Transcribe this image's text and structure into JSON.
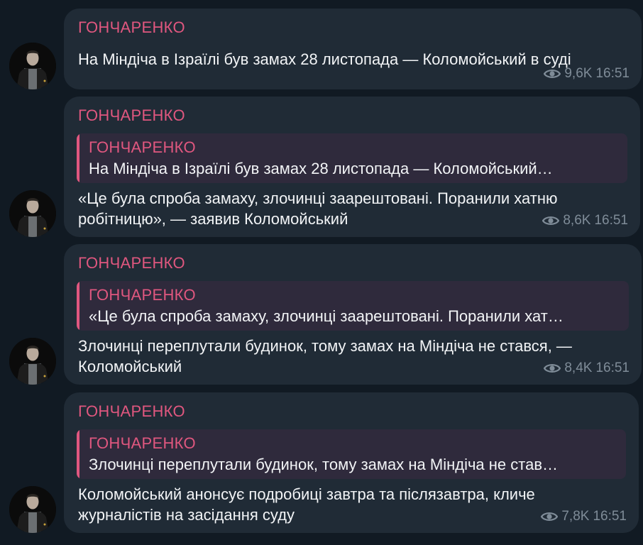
{
  "messages": [
    {
      "sender": "ГОНЧАРЕНКО",
      "reply": null,
      "lines": [
        "На Міндіча в Ізраїлі був замах 28 листопада — Коломойський в суді"
      ],
      "views": "9,6K",
      "time": "16:51"
    },
    {
      "sender": "ГОНЧАРЕНКО",
      "reply": {
        "sender": "ГОНЧАРЕНКО",
        "text": "На Міндіча в Ізраїлі був замах 28 листопада — Коломойський…"
      },
      "lines": [
        "«Це була спроба замаху, злочинці заарештовані. Поранили хатню",
        "робітницю», — заявив Коломойський"
      ],
      "views": "8,6K",
      "time": "16:51"
    },
    {
      "sender": "ГОНЧАРЕНКО",
      "reply": {
        "sender": "ГОНЧАРЕНКО",
        "text": "«Це була спроба замаху, злочинці заарештовані. Поранили хат…"
      },
      "lines": [
        "Злочинці переплутали будинок, тому замах на Міндіча не стався, —",
        "Коломойський"
      ],
      "views": "8,4K",
      "time": "16:51"
    },
    {
      "sender": "ГОНЧАРЕНКО",
      "reply": {
        "sender": "ГОНЧАРЕНКО",
        "text": "Злочинці переплутали будинок, тому замах на Міндіча не став…"
      },
      "lines": [
        "Коломойський анонсує подробиці завтра та післязавтра, кличе",
        "журналістів на засідання суду"
      ],
      "views": "7,8K",
      "time": "16:51"
    }
  ],
  "icons": {
    "views": "eye-icon",
    "avatar": "sender-avatar"
  },
  "colors": {
    "background": "#111a23",
    "bubble": "#202b36",
    "sender": "#e0577f",
    "reply_bg": "#2f2a3c",
    "text": "#f2f4f6",
    "meta": "#7f8c98"
  }
}
